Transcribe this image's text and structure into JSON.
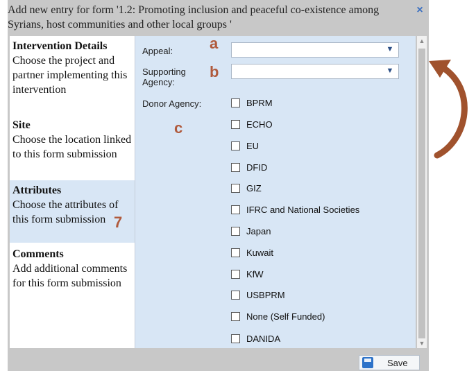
{
  "dialog": {
    "title": "Add new entry for form '1.2: Promoting inclusion and peaceful co-existence among Syrians, host communities and other local groups '",
    "close_icon": "close-icon"
  },
  "steps": [
    {
      "heading": "Intervention Details",
      "desc": "Choose the project and partner implementing this intervention"
    },
    {
      "heading": "Site",
      "desc": "Choose the location linked to this form submission"
    },
    {
      "heading": "Attributes",
      "desc": "Choose the attributes of this form submission",
      "active": true
    },
    {
      "heading": "Comments",
      "desc": "Add additional comments for this form submission"
    }
  ],
  "form": {
    "appeal_label": "Appeal:",
    "appeal_value": "",
    "agency_label": "Supporting Agency:",
    "agency_value": "",
    "donor_label": "Donor Agency:",
    "donors": [
      "BPRM",
      "ECHO",
      "EU",
      "DFID",
      "GIZ",
      "IFRC and National Societies",
      "Japan",
      "Kuwait",
      "KfW",
      "USBPRM",
      "None (Self Funded)",
      "DANIDA"
    ]
  },
  "footer": {
    "save_label": "Save"
  },
  "annotations": {
    "a": "a",
    "b": "b",
    "c": "c",
    "step": "7"
  },
  "colors": {
    "content_bg": "#d8e6f5",
    "annotation": "#b05a3c",
    "arrow": "#a0522d"
  }
}
